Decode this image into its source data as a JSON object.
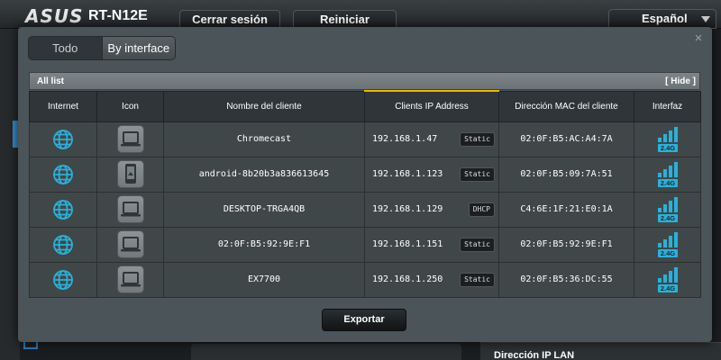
{
  "header": {
    "brand": "ASUS",
    "model": "RT-N12E",
    "logout_label": "Cerrar sesión",
    "reboot_label": "Reiniciar",
    "language": "Español"
  },
  "background": {
    "lan_ip_label": "Dirección IP LAN"
  },
  "modal": {
    "close_label": "×",
    "tabs": [
      {
        "label": "Todo",
        "active": false
      },
      {
        "label": "By interface",
        "active": true
      }
    ],
    "list_title": "All list",
    "hide_label": "[ Hide ]",
    "columns": [
      "Internet",
      "Icon",
      "Nombre del cliente",
      "Clients IP Address",
      "Dirección MAC del cliente",
      "Interfaz"
    ],
    "clients": [
      {
        "name": "Chromecast",
        "ip": "192.168.1.47",
        "ip_type": "Static",
        "mac": "02:0F:B5:AC:A4:7A",
        "device": "laptop-icon",
        "band": "2.4G"
      },
      {
        "name": "android-8b20b3a836613645",
        "ip": "192.168.1.123",
        "ip_type": "Static",
        "mac": "02:0F:B5:09:7A:51",
        "device": "phone-icon",
        "band": "2.4G"
      },
      {
        "name": "DESKTOP-TRGA4QB",
        "ip": "192.168.1.129",
        "ip_type": "DHCP",
        "mac": "C4:6E:1F:21:E0:1A",
        "device": "laptop-icon",
        "band": "2.4G"
      },
      {
        "name": "02:0F:B5:92:9E:F1",
        "ip": "192.168.1.151",
        "ip_type": "Static",
        "mac": "02:0F:B5:92:9E:F1",
        "device": "laptop-icon",
        "band": "2.4G"
      },
      {
        "name": "EX7700",
        "ip": "192.168.1.250",
        "ip_type": "Static",
        "mac": "02:0F:B5:36:DC:55",
        "device": "laptop-icon",
        "band": "2.4G"
      }
    ],
    "export_label": "Exportar"
  },
  "colors": {
    "accent_sort": "#f4b400",
    "globe": "#2ab1d9",
    "signal": "#2ab1d9"
  }
}
